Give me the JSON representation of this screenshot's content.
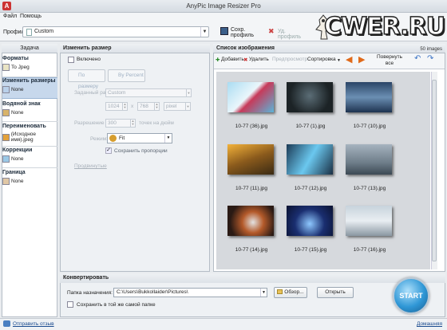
{
  "window": {
    "title": "AnyPic Image Resizer Pro",
    "app_icon": "A"
  },
  "menu": [
    "Файл",
    "Помощь"
  ],
  "toolbar": {
    "profile_label": "Профиль",
    "profile_value": "Custom",
    "save_profile": "Сохр. профиль",
    "delete_profile": "Уд. профиль"
  },
  "logo": {
    "text": "CWER.RU"
  },
  "sidebar": {
    "header": "Задача",
    "tasks": [
      {
        "title": "Форматы",
        "subtitle": "To Jpeg",
        "icon": "jpeg-icon"
      },
      {
        "title": "Изменить размеры",
        "subtitle": "None",
        "icon": "resize-icon",
        "selected": true
      },
      {
        "title": "Водяной знак",
        "subtitle": "None",
        "icon": "watermark-icon"
      },
      {
        "title": "Переименовать",
        "subtitle": "(Исходное имя).jpeg",
        "icon": "rename-icon"
      },
      {
        "title": "Коррекции",
        "subtitle": "None",
        "icon": "correction-icon"
      },
      {
        "title": "Граница",
        "subtitle": "None",
        "icon": "border-icon"
      }
    ]
  },
  "resize": {
    "header": "Изменить размер",
    "enabled_label": "Включено",
    "by_size": "По размеру",
    "by_percent": "By Percent",
    "preset_label": "Заданный ра",
    "preset_value": "Custom",
    "width": "1024",
    "height": "768",
    "unit": "pixel",
    "times": "x",
    "resolution_label": "Разрешение",
    "resolution_value": "300",
    "resolution_unit": "точек на дюйм",
    "mode_label": "Режим:",
    "mode_value": "Fit",
    "keep_ratio": "Сохранить пропорции",
    "advanced": "Продвинутые"
  },
  "images": {
    "header": "Список изображения",
    "count": "50 images",
    "add": "Добавить",
    "delete": "Удалить",
    "preview": "Предпросмотр",
    "sort": "Сортировка",
    "rotate_all": "Повернуть все",
    "items": [
      {
        "name": "10-77 (36).jpg"
      },
      {
        "name": "10-77 (1).jpg"
      },
      {
        "name": "10-77 (10).jpg"
      },
      {
        "name": "10-77 (11).jpg"
      },
      {
        "name": "10-77 (12).jpg"
      },
      {
        "name": "10-77 (13).jpg"
      },
      {
        "name": "10-77 (14).jpg"
      },
      {
        "name": "10-77 (15).jpg"
      },
      {
        "name": "10-77 (16).jpg"
      }
    ]
  },
  "convert": {
    "header": "Конвертировать",
    "dest_label": "Папка назначения:",
    "dest_value": "C:\\Users\\Bukkollaider\\Pictures\\",
    "browse": "Обзор...",
    "open": "Открыть",
    "same_folder": "Сохранить в той же самой папке",
    "start": "START"
  },
  "status": {
    "feedback": "Отправить отзыв",
    "home": "Домашняя"
  }
}
